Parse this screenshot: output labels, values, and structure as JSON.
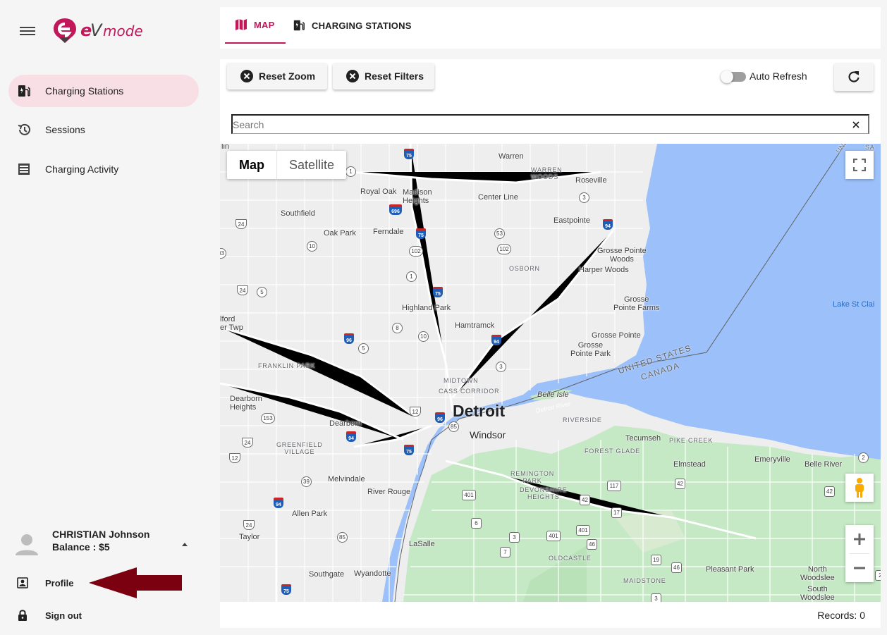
{
  "brand": {
    "name": "eVmode",
    "accent": "#c2185b",
    "logo_dark": "#424242"
  },
  "sidebar": {
    "menu_icon": "hamburger-menu-icon",
    "items": [
      {
        "label": "Charging Stations",
        "icon": "ev-station-icon",
        "active": true
      },
      {
        "label": "Sessions",
        "icon": "history-icon",
        "active": false
      },
      {
        "label": "Charging Activity",
        "icon": "list-alt-icon",
        "active": false
      }
    ],
    "user": {
      "name": "CHRISTIAN Johnson",
      "balance": "Balance : $5",
      "avatar_icon": "person-avatar-icon",
      "caret_icon": "caret-up-icon"
    },
    "user_menu": [
      {
        "label": "Profile",
        "icon": "account-box-icon"
      },
      {
        "label": "Sign out",
        "icon": "lock-icon"
      }
    ],
    "annotation_arrow_color": "#7b0010"
  },
  "tabs": [
    {
      "label": "MAP",
      "icon": "map-icon",
      "active": true
    },
    {
      "label": "CHARGING STATIONS",
      "icon": "ev-station-icon",
      "active": false
    }
  ],
  "toolbar": {
    "reset_zoom": "Reset Zoom",
    "reset_filters": "Reset Filters",
    "auto_refresh_label": "Auto Refresh",
    "auto_refresh_on": false,
    "refresh_icon": "refresh-icon"
  },
  "search": {
    "placeholder": "Search",
    "value": "",
    "clear_icon": "close-icon"
  },
  "map": {
    "type_options": [
      "Map",
      "Satellite"
    ],
    "selected_type": "Map",
    "water_color": "#9cc0f9",
    "park_color": "#c5e8c5",
    "labels": {
      "detroit": "Detroit",
      "windsor": "Windsor",
      "warren": "Warren",
      "warren_woods": "WARREN\nWOODS",
      "roseville": "Roseville",
      "royal_oak": "Royal Oak",
      "madison_heights": "Madison\nHeights",
      "center_line": "Center Line",
      "southfield": "Southfield",
      "eastpointe": "Eastpointe",
      "oak_park": "Oak Park",
      "ferndale": "Ferndale",
      "grosse_pointe_woods": "Grosse Pointe\nWoods",
      "harper_woods": "Harper Woods",
      "osborn": "OSBORN",
      "grosse_pointe_farms": "Grosse\nPointe Farms",
      "lake_st_clair": "Lake St Clai",
      "highland_park": "Highland Park",
      "hamtramck": "Hamtramck",
      "grosse_pointe": "Grosse Pointe",
      "grosse_pointe_park": "Grosse\nPointe Park",
      "redford": "lford\ner Twp",
      "franklin_park": "FRANKLIN PARK",
      "midtown": "MIDTOWN",
      "cass_corridor": "CASS CORRIDOR",
      "united_states": "UNITED STATES",
      "canada": "CANADA",
      "belle_isle": "Belle Isle",
      "detroit_river": "Detroit River",
      "dearborn_heights": "Dearborn\nHeights",
      "dearborn": "Dearborn",
      "riverside": "RIVERSIDE",
      "tecumseh": "Tecumseh",
      "pike_creek": "PIKE CREEK",
      "greenfield_village": "GREENFIELD\nVILLAGE",
      "forest_glade": "FOREST GLADE",
      "elmstead": "Elmstead",
      "emeryville": "Emeryville",
      "belle_river": "Belle River",
      "melvindale": "Melvindale",
      "remington_park": "REMINGTON\nPARK",
      "river_rouge": "River Rouge",
      "devonshire_heights": "DEVONSHIRE\nHEIGHTS",
      "allen_park": "Allen Park",
      "taylor": "Taylor",
      "lasalle": "LaSalle",
      "oldcastle": "OLDCASTLE",
      "southgate": "Southgate",
      "wyandotte": "Wyandotte",
      "maidstone": "MAIDSTONE",
      "pleasant_park": "Pleasant Park",
      "north_woodslee": "North\nWoodslee",
      "south_woodslee": "South\nWoodslee",
      "edge_lin": "lin",
      "uni_top": "UNI",
      "sa_top": "SA"
    },
    "fullscreen_icon": "fullscreen-icon",
    "pegman_icon": "pegman-icon",
    "zoom_in_icon": "zoom-in-plus-icon",
    "zoom_out_icon": "zoom-out-minus-icon",
    "shields": {
      "i75_a": "75",
      "i75_b": "75",
      "i75_c": "75",
      "i75_d": "75",
      "i75_e": "75",
      "i696": "696",
      "i94_a": "94",
      "i94_b": "94",
      "i94_c": "94",
      "i94_d": "94",
      "i94_e": "94",
      "i96_a": "96",
      "i96_b": "96",
      "m1_a": "1",
      "m1_b": "1",
      "m3_a": "3",
      "m3_b": "3",
      "m3_c": "3",
      "m24_a": "24",
      "m24_b": "24",
      "m24_c": "24",
      "m24_d": "24",
      "m10_a": "10",
      "m10_b": "10",
      "m53": "53",
      "m102_a": "102",
      "m102_b": "102",
      "m5_a": "5",
      "m5_b": "5",
      "m8": "8",
      "m12_a": "12",
      "m12_b": "12",
      "m153": "153",
      "m39": "39",
      "m85": "85",
      "m85_b": "85",
      "m2": "2",
      "m401_a": "401",
      "m401_b": "401",
      "m401_c": "401",
      "m6": "6",
      "m7": "7",
      "m3_d": "3",
      "m3_e": "3",
      "m46_a": "46",
      "m46_b": "46",
      "m117": "117",
      "m42_a": "42",
      "m42_b": "42",
      "m42_c": "42",
      "m17": "17",
      "m19": "19",
      "m2_b": "2",
      "m5_c": "5",
      "m03": "03"
    }
  },
  "footer": {
    "records": "Records: 0"
  }
}
